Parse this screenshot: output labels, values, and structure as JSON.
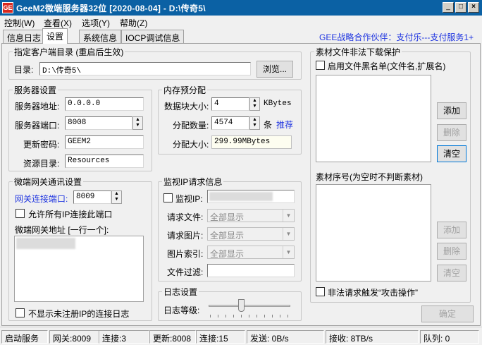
{
  "window": {
    "icon": "GE",
    "title": "GeeM2微端服务器32位 [2020-08-04] - D:\\传奇5\\",
    "controls": {
      "minimize": "_",
      "maximize": "□",
      "close": "×"
    }
  },
  "menu": [
    "控制(W)",
    "查看(X)",
    "选项(Y)",
    "帮助(Z)"
  ],
  "tabs": [
    "信息日志",
    "设置",
    "系统信息",
    "IOCP调试信息"
  ],
  "active_tab": 1,
  "partner_text": "GEE战略合作伙伴：支付乐---支付服务1+",
  "client_dir": {
    "group_label": "指定客户端目录 (重启后生效)",
    "label": "目录:",
    "value": "D:\\传奇5\\",
    "browse_button": "浏览..."
  },
  "server": {
    "group_label": "服务器设置",
    "address_label": "服务器地址:",
    "address": "0.0.0.0",
    "port_label": "服务器端口:",
    "port": "8008",
    "password_label": "更新密码:",
    "password": "GEEM2",
    "resource_label": "资源目录:",
    "resource": "Resources"
  },
  "memory": {
    "group_label": "内存预分配",
    "block_label": "数据块大小:",
    "block": "4",
    "block_unit": "KBytes",
    "count_label": "分配数量:",
    "count": "4574",
    "count_unit": "条",
    "recommend": "推荐",
    "size_label": "分配大小:",
    "size": "299.99MBytes"
  },
  "gateway": {
    "group_label": "微端网关通讯设置",
    "port_label": "网关连接端口:",
    "port": "8009",
    "allow_all_label": "允许所有IP连接此端口",
    "address_label": "微端网关地址 [一行一个]:",
    "hide_unregistered_label": "不显示未注册IP的连接日志"
  },
  "monitor": {
    "group_label": "监视IP请求信息",
    "ip_label": "监视IP:",
    "file_label": "请求文件:",
    "file_value": "全部显示",
    "image_label": "请求图片:",
    "image_value": "全部显示",
    "index_label": "图片索引:",
    "index_value": "全部显示",
    "filter_label": "文件过滤:"
  },
  "log": {
    "group_label": "日志设置",
    "level_label": "日志等级:"
  },
  "protect": {
    "group_label": "素材文件非法下载保护",
    "blacklist_label": "启用文件黑名单(文件名,扩展名)",
    "add": "添加",
    "delete": "删除",
    "clear": "清空",
    "seq_label": "素材序号(为空时不判断素材)",
    "attack_label": "非法请求触发“攻击操作”"
  },
  "ok_button": "确定",
  "status": {
    "start": "启动服务",
    "gateway": "网关:8009",
    "gateway_conn": "连接:3",
    "update": "更新:8008",
    "update_conn": "连接:15",
    "send": "发送: 0B/s",
    "recv": "接收: 8TB/s",
    "queue": "队列: 0"
  }
}
